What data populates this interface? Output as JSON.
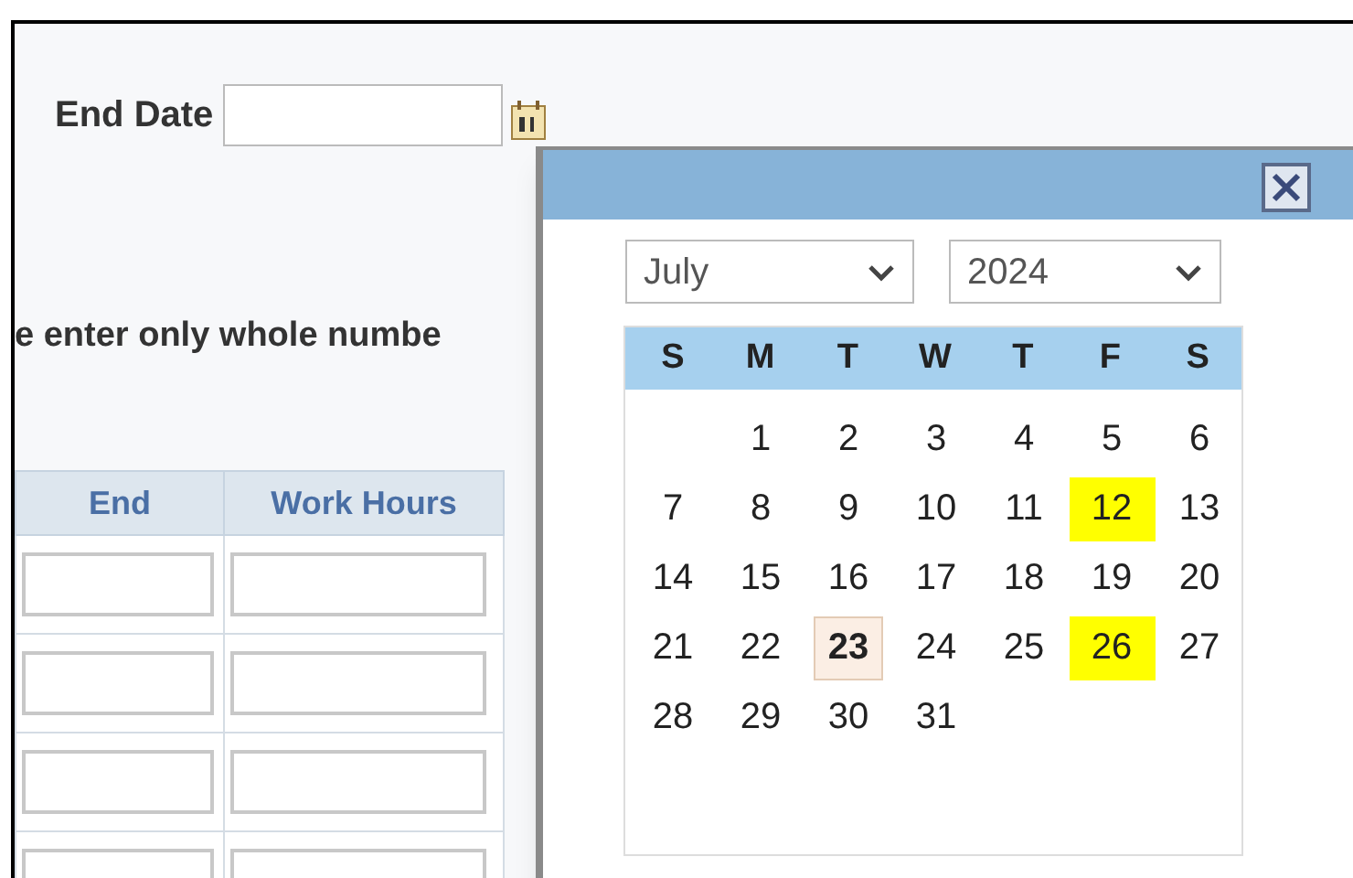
{
  "end_date": {
    "label": "End Date"
  },
  "instruction": "e enter only whole numbe",
  "table": {
    "columns": [
      "End",
      "Work Hours"
    ],
    "rows": [
      {
        "editable": true
      },
      {
        "editable": true
      },
      {
        "editable": true
      },
      {
        "editable": true
      }
    ]
  },
  "date_picker": {
    "month": "July",
    "year": "2024",
    "weekdays": [
      "S",
      "M",
      "T",
      "W",
      "T",
      "F",
      "S"
    ],
    "weeks": [
      [
        {
          "day": "1",
          "highlighted": false,
          "today": false
        },
        {
          "day": "2",
          "highlighted": false,
          "today": false
        },
        {
          "day": "3",
          "highlighted": false,
          "today": false
        },
        {
          "day": "4",
          "highlighted": false,
          "today": false
        },
        {
          "day": "5",
          "highlighted": false,
          "today": false
        },
        {
          "day": "6",
          "highlighted": false,
          "today": false
        }
      ],
      [
        {
          "day": "7",
          "highlighted": false,
          "today": false
        },
        {
          "day": "8",
          "highlighted": false,
          "today": false
        },
        {
          "day": "9",
          "highlighted": false,
          "today": false
        },
        {
          "day": "10",
          "highlighted": false,
          "today": false
        },
        {
          "day": "11",
          "highlighted": false,
          "today": false
        },
        {
          "day": "12",
          "highlighted": true,
          "today": false
        },
        {
          "day": "13",
          "highlighted": false,
          "today": false
        }
      ],
      [
        {
          "day": "14",
          "highlighted": false,
          "today": false
        },
        {
          "day": "15",
          "highlighted": false,
          "today": false
        },
        {
          "day": "16",
          "highlighted": false,
          "today": false
        },
        {
          "day": "17",
          "highlighted": false,
          "today": false
        },
        {
          "day": "18",
          "highlighted": false,
          "today": false
        },
        {
          "day": "19",
          "highlighted": false,
          "today": false
        },
        {
          "day": "20",
          "highlighted": false,
          "today": false
        }
      ],
      [
        {
          "day": "21",
          "highlighted": false,
          "today": false
        },
        {
          "day": "22",
          "highlighted": false,
          "today": false
        },
        {
          "day": "23",
          "highlighted": false,
          "today": true
        },
        {
          "day": "24",
          "highlighted": false,
          "today": false
        },
        {
          "day": "25",
          "highlighted": false,
          "today": false
        },
        {
          "day": "26",
          "highlighted": true,
          "today": false
        },
        {
          "day": "27",
          "highlighted": false,
          "today": false
        }
      ],
      [
        {
          "day": "28",
          "highlighted": false,
          "today": false
        },
        {
          "day": "29",
          "highlighted": false,
          "today": false
        },
        {
          "day": "30",
          "highlighted": false,
          "today": false
        },
        {
          "day": "31",
          "highlighted": false,
          "today": false
        }
      ]
    ]
  }
}
